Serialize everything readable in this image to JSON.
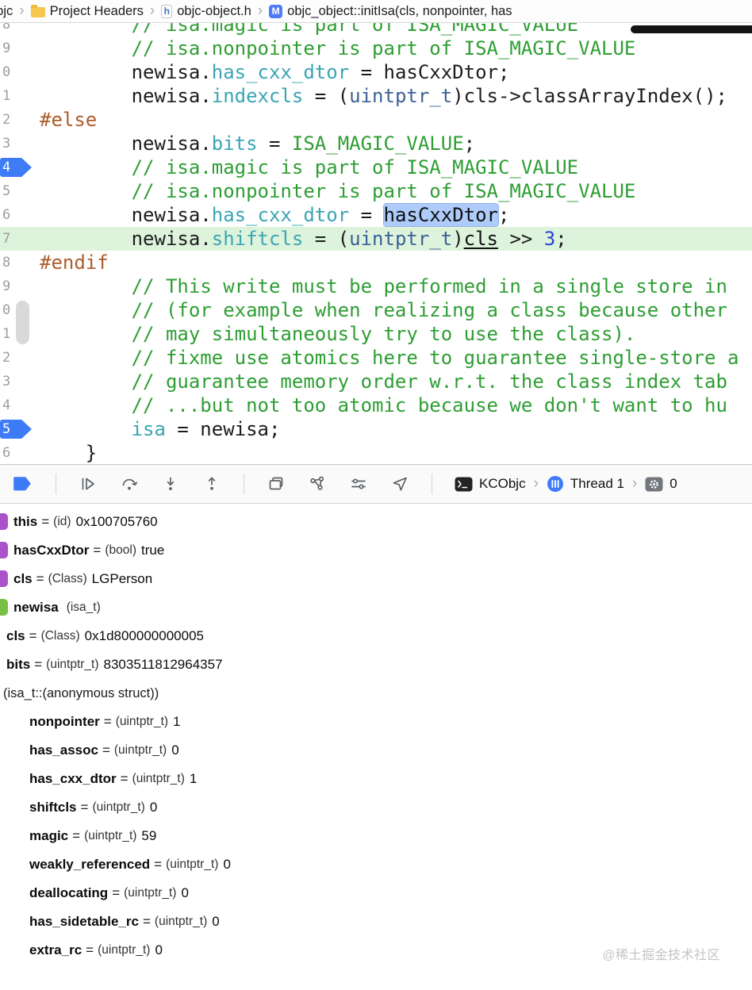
{
  "breadcrumb": {
    "items": [
      {
        "label": "objc",
        "icon": null
      },
      {
        "label": "Project Headers",
        "icon": "folder"
      },
      {
        "label": "objc-object.h",
        "icon": "h-file"
      },
      {
        "label": "objc_object::initIsa(cls, nonpointer, has",
        "icon": "m-file"
      }
    ]
  },
  "editor": {
    "colors": {
      "plain": "#1d1d1f",
      "comment": "#2E9E33",
      "macro": "#2E9E33",
      "property": "#3BA5B4",
      "type": "#3C6296",
      "number": "#2745CF",
      "preprocessor": "#AD5C2B"
    },
    "lines": [
      {
        "num": "8",
        "indent": 8,
        "tokens": [
          [
            "comment",
            "// isa.magic is part of ISA_MAGIC_VALUE"
          ]
        ]
      },
      {
        "num": "9",
        "indent": 8,
        "tokens": [
          [
            "comment",
            "// isa.nonpointer is part of ISA_MAGIC_VALUE"
          ]
        ]
      },
      {
        "num": "0",
        "indent": 8,
        "tokens": [
          [
            "plain",
            "newisa."
          ],
          [
            "property",
            "has_cxx_dtor"
          ],
          [
            "plain",
            " = hasCxxDtor;"
          ]
        ]
      },
      {
        "num": "1",
        "indent": 8,
        "tokens": [
          [
            "plain",
            "newisa."
          ],
          [
            "property",
            "indexcls"
          ],
          [
            "plain",
            " = ("
          ],
          [
            "type",
            "uintptr_t"
          ],
          [
            "plain",
            ")cls->classArrayIndex();"
          ]
        ]
      },
      {
        "num": "2",
        "indent": 0,
        "tokens": [
          [
            "preprocessor",
            "#else"
          ]
        ]
      },
      {
        "num": "3",
        "indent": 8,
        "tokens": [
          [
            "plain",
            "newisa."
          ],
          [
            "property",
            "bits"
          ],
          [
            "plain",
            " = "
          ],
          [
            "macro",
            "ISA_MAGIC_VALUE"
          ],
          [
            "plain",
            ";"
          ]
        ]
      },
      {
        "num": "4",
        "indent": 8,
        "breakpoint": true,
        "tokens": [
          [
            "comment",
            "// isa.magic is part of ISA_MAGIC_VALUE"
          ]
        ]
      },
      {
        "num": "5",
        "indent": 8,
        "tokens": [
          [
            "comment",
            "// isa.nonpointer is part of ISA_MAGIC_VALUE"
          ]
        ]
      },
      {
        "num": "6",
        "indent": 8,
        "tokens": [
          [
            "plain",
            "newisa."
          ],
          [
            "property",
            "has_cxx_dtor"
          ],
          [
            "plain",
            " = "
          ],
          [
            "selected",
            "hasCxxDtor"
          ],
          [
            "plain",
            ";"
          ]
        ]
      },
      {
        "num": "7",
        "indent": 8,
        "current": true,
        "tokens": [
          [
            "plain",
            "newisa."
          ],
          [
            "property",
            "shiftcls"
          ],
          [
            "plain",
            " = ("
          ],
          [
            "type",
            "uintptr_t"
          ],
          [
            "plain",
            ")"
          ],
          [
            "underline",
            "cls"
          ],
          [
            "plain",
            " >> "
          ],
          [
            "number",
            "3"
          ],
          [
            "plain",
            ";"
          ]
        ]
      },
      {
        "num": "8",
        "indent": 0,
        "tokens": [
          [
            "preprocessor",
            "#endif"
          ]
        ]
      },
      {
        "num": "9",
        "indent": 8,
        "tokens": [
          [
            "comment",
            "// This write must be performed in a single store in"
          ]
        ]
      },
      {
        "num": "0",
        "indent": 8,
        "tokens": [
          [
            "comment",
            "// (for example when realizing a class because other"
          ]
        ]
      },
      {
        "num": "1",
        "indent": 8,
        "tokens": [
          [
            "comment",
            "// may simultaneously try to use the class)."
          ]
        ]
      },
      {
        "num": "2",
        "indent": 8,
        "tokens": [
          [
            "comment",
            "// fixme use atomics here to guarantee single-store a"
          ]
        ]
      },
      {
        "num": "3",
        "indent": 8,
        "tokens": [
          [
            "comment",
            "// guarantee memory order w.r.t. the class index tab"
          ]
        ]
      },
      {
        "num": "4",
        "indent": 8,
        "tokens": [
          [
            "comment",
            "// ...but not too atomic because we don't want to hu"
          ]
        ]
      },
      {
        "num": "5",
        "indent": 8,
        "breakpoint": true,
        "tokens": [
          [
            "property",
            "isa"
          ],
          [
            "plain",
            " = newisa;"
          ]
        ]
      },
      {
        "num": "6",
        "indent": 4,
        "tokens": [
          [
            "plain",
            "}"
          ]
        ]
      }
    ]
  },
  "debugbar": {
    "icons": [
      "breakpoints-toggle",
      "continue",
      "step-over",
      "step-into",
      "step-out",
      "view-hierarchy",
      "memory-graph",
      "environment-overrides",
      "simulate-location"
    ],
    "process": "KCObjc",
    "thread": "Thread 1",
    "frame": "0"
  },
  "variables": {
    "icon_colors": {
      "purple": "#AB51C9",
      "green": "#77C043"
    },
    "rows": [
      {
        "icon": "purple",
        "pad": 17,
        "name": "this",
        "type": "(id)",
        "value": "0x100705760"
      },
      {
        "icon": "purple",
        "pad": 17,
        "name": "hasCxxDtor",
        "type": "(bool)",
        "value": "true"
      },
      {
        "icon": "purple",
        "pad": 17,
        "name": "cls",
        "type": "(Class)",
        "value": "LGPerson"
      },
      {
        "icon": "green",
        "pad": 17,
        "name": "newisa",
        "type": "(isa_t)",
        "value": "",
        "eq": false
      },
      {
        "pad": 8,
        "name": "cls",
        "type": "(Class)",
        "value": "0x1d800000000005"
      },
      {
        "pad": 8,
        "name": "bits",
        "type": "(uintptr_t)",
        "value": "8303511812964357"
      },
      {
        "pad": 4,
        "anon": "(isa_t::(anonymous struct))"
      },
      {
        "pad": 37,
        "name": "nonpointer",
        "type": "(uintptr_t)",
        "value": "1"
      },
      {
        "pad": 37,
        "name": "has_assoc",
        "type": "(uintptr_t)",
        "value": "0"
      },
      {
        "pad": 37,
        "name": "has_cxx_dtor",
        "type": "(uintptr_t)",
        "value": "1"
      },
      {
        "pad": 37,
        "name": "shiftcls",
        "type": "(uintptr_t)",
        "value": "0"
      },
      {
        "pad": 37,
        "name": "magic",
        "type": "(uintptr_t)",
        "value": "59"
      },
      {
        "pad": 37,
        "name": "weakly_referenced",
        "type": "(uintptr_t)",
        "value": "0"
      },
      {
        "pad": 37,
        "name": "deallocating",
        "type": "(uintptr_t)",
        "value": "0"
      },
      {
        "pad": 37,
        "name": "has_sidetable_rc",
        "type": "(uintptr_t)",
        "value": "0"
      },
      {
        "pad": 37,
        "name": "extra_rc",
        "type": "(uintptr_t)",
        "value": "0"
      }
    ]
  },
  "watermark": "@稀土掘金技术社区"
}
